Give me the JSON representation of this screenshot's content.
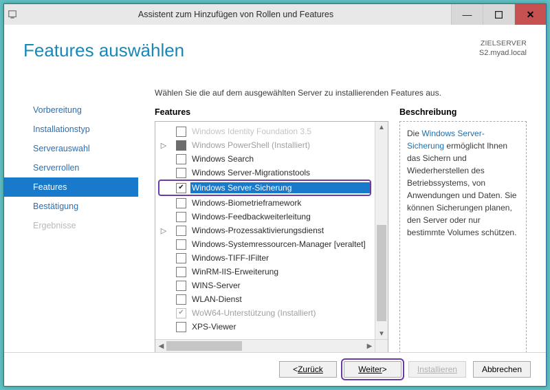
{
  "window": {
    "title": "Assistent zum Hinzufügen von Rollen und Features"
  },
  "header": {
    "title": "Features auswählen",
    "target_label": "ZIELSERVER",
    "target_server": "S2.myad.local"
  },
  "sidebar": {
    "items": [
      {
        "label": "Vorbereitung",
        "active": false
      },
      {
        "label": "Installationstyp",
        "active": false
      },
      {
        "label": "Serverauswahl",
        "active": false
      },
      {
        "label": "Serverrollen",
        "active": false
      },
      {
        "label": "Features",
        "active": true
      },
      {
        "label": "Bestätigung",
        "active": false
      },
      {
        "label": "Ergebnisse",
        "active": false,
        "disabled": true
      }
    ]
  },
  "content": {
    "instruction": "Wählen Sie die auf dem ausgewählten Server zu installierenden Features aus.",
    "features_heading": "Features",
    "description_heading": "Beschreibung"
  },
  "features": [
    {
      "label": "Windows Identity Foundation 3.5",
      "checked": false,
      "disabled": false
    },
    {
      "label": "Windows PowerShell (Installiert)",
      "checked": "partial",
      "disabled": true,
      "expandable": true
    },
    {
      "label": "Windows Search",
      "checked": false
    },
    {
      "label": "Windows Server-Migrationstools",
      "checked": false
    },
    {
      "label": "Windows Server-Sicherung",
      "checked": true,
      "selected": true,
      "highlighted": true
    },
    {
      "label": "Windows-Biometrieframework",
      "checked": false
    },
    {
      "label": "Windows-Feedbackweiterleitung",
      "checked": false
    },
    {
      "label": "Windows-Prozessaktivierungsdienst",
      "checked": false,
      "expandable": true
    },
    {
      "label": "Windows-Systemressourcen-Manager [veraltet]",
      "checked": false
    },
    {
      "label": "Windows-TIFF-IFilter",
      "checked": false
    },
    {
      "label": "WinRM-IIS-Erweiterung",
      "checked": false
    },
    {
      "label": "WINS-Server",
      "checked": false
    },
    {
      "label": "WLAN-Dienst",
      "checked": false
    },
    {
      "label": "WoW64-Unterstützung (Installiert)",
      "checked": true,
      "disabled": true
    },
    {
      "label": "XPS-Viewer",
      "checked": false
    }
  ],
  "description": {
    "prefix": "Die ",
    "link": "Windows Server-Sicherung",
    "suffix": " ermöglicht Ihnen das Sichern und Wiederherstellen des Betriebssystems, von Anwendungen und Daten. Sie können Sicherungen planen, den Server oder nur bestimmte Volumes schützen."
  },
  "footer": {
    "back": "Zurück",
    "next": "Weiter",
    "install": "Installieren",
    "cancel": "Abbrechen"
  },
  "colors": {
    "accent": "#1979ca",
    "heading": "#1a87b9",
    "link": "#1a6fb0",
    "highlight_border": "#6a3aa8",
    "close_btn": "#c75050"
  }
}
